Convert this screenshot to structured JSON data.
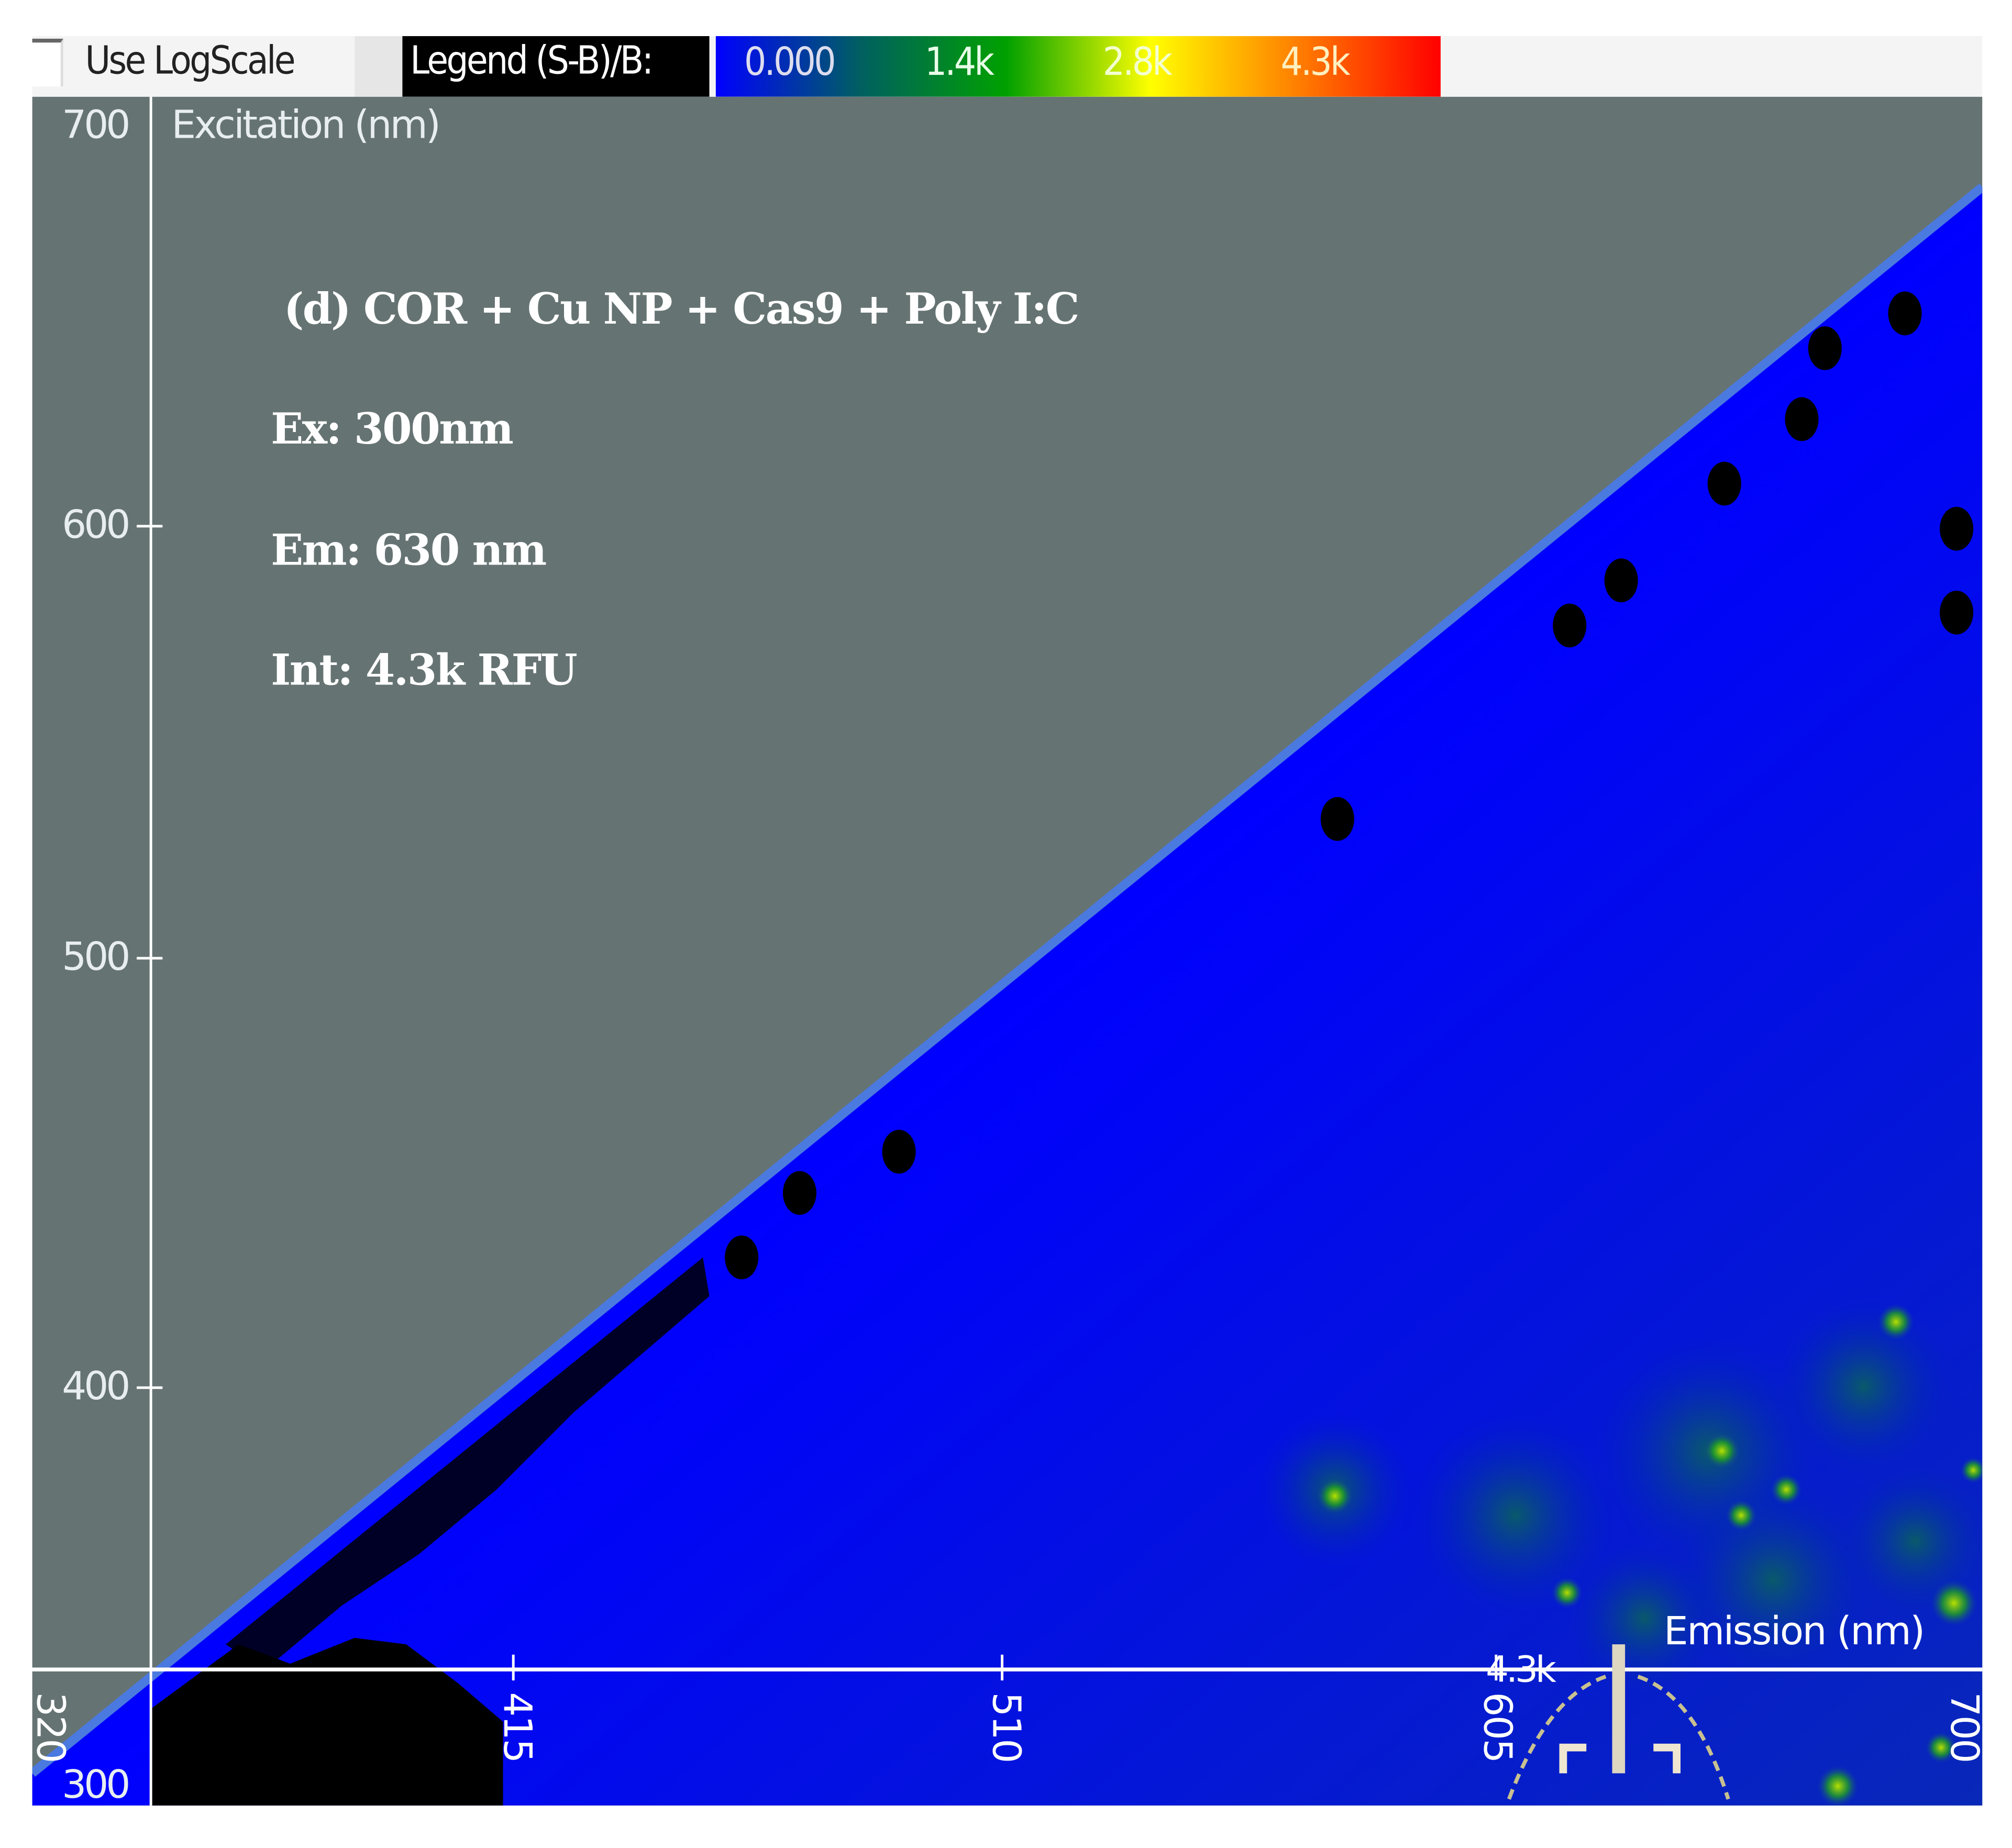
{
  "toolbar": {
    "log_scale_label": "Use LogScale",
    "log_scale_checked": false,
    "legend_label": "Legend (S-B)/B:",
    "colorbar_ticks": [
      "0.000",
      "1.4k",
      "2.8k",
      "4.3k"
    ],
    "colorbar_colors": [
      "#0000ff",
      "#006060",
      "#00a000",
      "#ffff00",
      "#ff8000",
      "#ff0000"
    ]
  },
  "annotations": {
    "title": "(d) COR + Cu NP + Cas9 + Poly I:C",
    "ex": "Ex: 300nm",
    "em": "Em: 630 nm",
    "int": "Int: 4.3k RFU"
  },
  "cursor_readout": "4.3k",
  "chart_data": {
    "type": "heatmap",
    "title": "(d) COR + Cu NP + Cas9 + Poly I:C",
    "xlabel": "Emission (nm)",
    "ylabel": "Excitation (nm)",
    "x_ticks": [
      "320",
      "415",
      "510",
      "605",
      "700"
    ],
    "y_ticks": [
      "700",
      "600",
      "500",
      "400",
      "300"
    ],
    "xlim": [
      320,
      700
    ],
    "ylim": [
      300,
      700
    ],
    "color_scale": {
      "min": 0,
      "max": 4300,
      "unit": "RFU",
      "ticks": [
        "0.000",
        "1.4k",
        "2.8k",
        "4.3k"
      ]
    },
    "peak": {
      "excitation_nm": 300,
      "emission_nm": 630,
      "intensity": "4.3k RFU"
    },
    "masked_region": "excitation >= emission (gray)",
    "colors": {
      "background": "#667373",
      "signal_low": "#0000ff"
    }
  }
}
